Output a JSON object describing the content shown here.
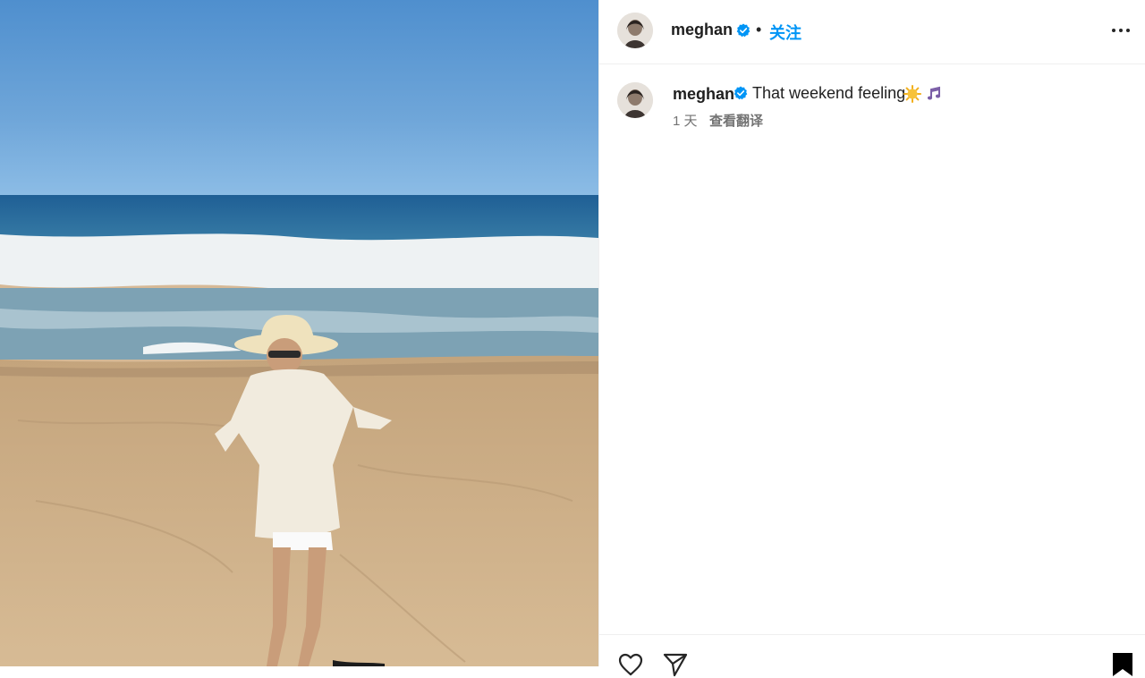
{
  "post": {
    "author": "meghan",
    "follow_label": "关注",
    "separator": "•",
    "more_icon": "more-horizontal-icon"
  },
  "comment": {
    "author": "meghan",
    "text": "That weekend feeling",
    "emojis": [
      "sun-emoji",
      "music-notes-emoji"
    ],
    "time": "1 天",
    "translate_label": "查看翻译"
  },
  "actions": {
    "icons": [
      "heart-icon",
      "send-icon",
      "bookmark-icon"
    ]
  },
  "colors": {
    "follow_blue": "#0095f6",
    "verified_blue": "#0095f6",
    "meta_gray": "#737373",
    "divider": "#efefef"
  }
}
